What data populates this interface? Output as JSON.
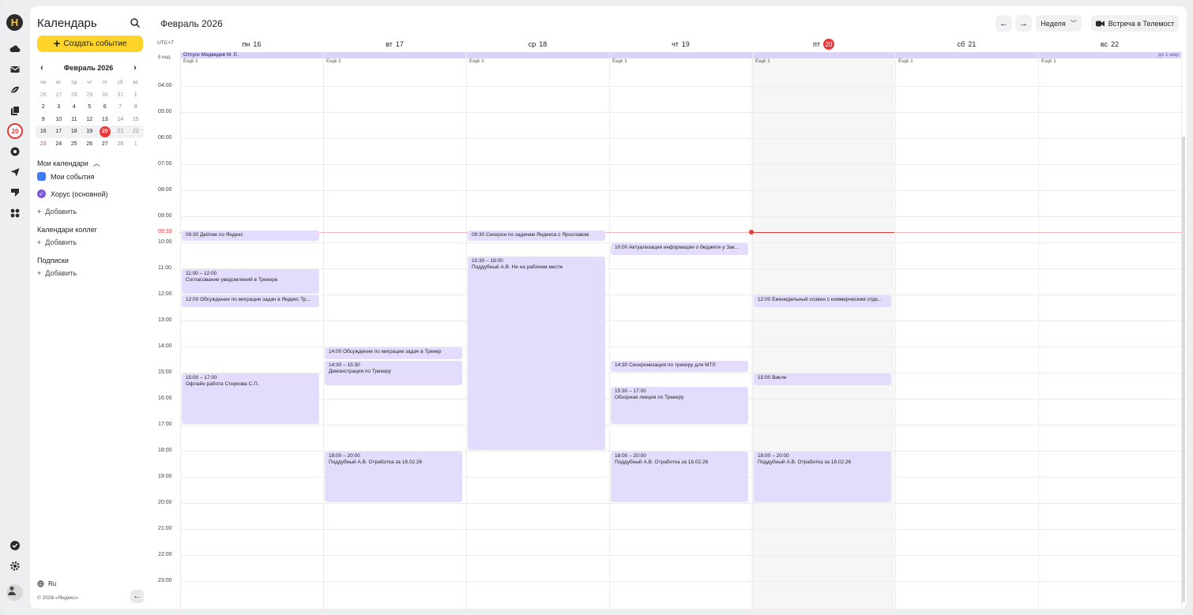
{
  "app": {
    "logo_letter": "H",
    "title": "Календарь",
    "create_label": "Создать событие",
    "today_badge": "20"
  },
  "colors": {
    "accent_yellow": "#fed42b",
    "today_red": "#e63a3a",
    "event_bg": "#e4dcfc",
    "my_events": "#3d7cf6",
    "horus": "#7c5bd8"
  },
  "mini_calendar": {
    "month_label": "Февраль 2026",
    "weekdays": [
      "пн",
      "вт",
      "ср",
      "чт",
      "пт",
      "сб",
      "вс"
    ],
    "weeks": [
      [
        "26",
        "27",
        "28",
        "29",
        "30",
        "31",
        "1"
      ],
      [
        "2",
        "3",
        "4",
        "5",
        "6",
        "7",
        "8"
      ],
      [
        "9",
        "10",
        "11",
        "12",
        "13",
        "14",
        "15"
      ],
      [
        "16",
        "17",
        "18",
        "19",
        "20",
        "21",
        "22"
      ],
      [
        "23",
        "24",
        "25",
        "26",
        "27",
        "28",
        "1"
      ]
    ]
  },
  "sidebar": {
    "my_calendars": "Мои календари",
    "my_events": "Мои события",
    "horus": "Хорус (основной)",
    "add": "Добавить",
    "colleagues": "Календари коллег",
    "subscriptions": "Подписки",
    "lang": "Ru",
    "copyright": "© 2026 «Яндекс»"
  },
  "header": {
    "month": "Февраль 2026",
    "view": "Неделя",
    "telemost": "Встреча в Телемост"
  },
  "grid": {
    "timezone": "UTC+7",
    "week_label": "8 нед.",
    "days": [
      {
        "dow": "пн",
        "num": "16"
      },
      {
        "dow": "вт",
        "num": "17"
      },
      {
        "dow": "ср",
        "num": "18"
      },
      {
        "dow": "чт",
        "num": "19"
      },
      {
        "dow": "пт",
        "num": "20"
      },
      {
        "dow": "сб",
        "num": "21"
      },
      {
        "dow": "вс",
        "num": "22"
      }
    ],
    "more_label": "Ещё 1",
    "allday_event": "Отпуск Медведев М. Е.",
    "allday_until": "до 1 мар",
    "now_time": "09:33",
    "hours": [
      "04:00",
      "05:00",
      "06:00",
      "07:00",
      "08:00",
      "09:00",
      "10:00",
      "11:00",
      "12:00",
      "13:00",
      "14:00",
      "15:00",
      "16:00",
      "17:00",
      "18:00",
      "19:00",
      "20:00",
      "21:00",
      "22:00",
      "23:00"
    ]
  },
  "events": [
    {
      "day": 0,
      "start": "09:30",
      "end": "09:55",
      "text": "09:30 Дейлик по Яндекс"
    },
    {
      "day": 0,
      "start": "11:00",
      "end": "12:00",
      "time": "11:00 – 12:00",
      "title": "Согласование уведомлений в Трекере"
    },
    {
      "day": 0,
      "start": "12:00",
      "end": "12:30",
      "text": "12:00 Обсуждение по миграции задач в Яндекс Тр..."
    },
    {
      "day": 0,
      "start": "15:00",
      "end": "17:00",
      "time": "15:00 – 17:00",
      "title": "Офлайн работа Стеркова С.П."
    },
    {
      "day": 1,
      "start": "14:00",
      "end": "14:30",
      "text": "14:00 Обсуждение по миграции задач в Трекер"
    },
    {
      "day": 1,
      "start": "14:30",
      "end": "15:30",
      "time": "14:30 – 15:30",
      "title": "Демонстрация по Трекеру"
    },
    {
      "day": 1,
      "start": "18:00",
      "end": "20:00",
      "time": "18:00 – 20:00",
      "title": "Поддубный А.В. Отработка за 18.02.26"
    },
    {
      "day": 2,
      "start": "09:30",
      "end": "09:55",
      "text": "09:30 Синхрон по задачам Яндекса с Ярославом"
    },
    {
      "day": 2,
      "start": "10:30",
      "end": "18:00",
      "time": "10:30 – 18:00",
      "title": "Поддубный А.В. Не на рабочем месте"
    },
    {
      "day": 3,
      "start": "10:00",
      "end": "10:30",
      "text": "10:00 Актуализация информации о бюджете у Зак..."
    },
    {
      "day": 3,
      "start": "14:30",
      "end": "15:00",
      "text": "14:30 Синхронизация по трекеру для МТЛ"
    },
    {
      "day": 3,
      "start": "15:30",
      "end": "17:00",
      "time": "15:30 – 17:00",
      "title": "Обзорная лекция по Трекеру"
    },
    {
      "day": 3,
      "start": "18:00",
      "end": "20:00",
      "time": "18:00 – 20:00",
      "title": "Поддубный А.В. Отработка за 18.02.26"
    },
    {
      "day": 4,
      "start": "12:00",
      "end": "12:30",
      "text": "12:00 Еженедельный созвон с коммерческим отде..."
    },
    {
      "day": 4,
      "start": "15:00",
      "end": "15:30",
      "text": "15:00 Викли"
    },
    {
      "day": 4,
      "start": "18:00",
      "end": "20:00",
      "time": "18:00 – 20:00",
      "title": "Поддубный А.В. Отработка за 18.02.26"
    }
  ]
}
